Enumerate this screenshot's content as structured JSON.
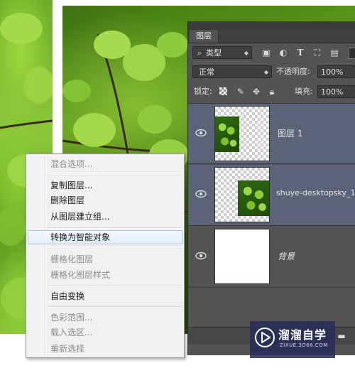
{
  "layers_panel": {
    "tab_title": "图层",
    "filter_select": "类型",
    "blend_mode": "正常",
    "opacity_label": "不透明度:",
    "opacity_value": "100%",
    "lock_label": "锁定:",
    "fill_label": "填充:",
    "fill_value": "100%",
    "layers": [
      {
        "name": "图层 1",
        "visible": true,
        "selected": true
      },
      {
        "name": "shuye-desktopsky_1-",
        "visible": true,
        "selected": true
      },
      {
        "name": "背景",
        "visible": true,
        "selected": false
      }
    ]
  },
  "context_menu": {
    "items": [
      {
        "label": "混合选项...",
        "enabled": false
      },
      {
        "label": "复制图层...",
        "enabled": true
      },
      {
        "label": "删除图层",
        "enabled": true
      },
      {
        "label": "从图层建立组...",
        "enabled": true
      },
      {
        "label": "转换为智能对象",
        "enabled": true,
        "highlighted": true
      },
      {
        "label": "栅格化图层",
        "enabled": false
      },
      {
        "label": "栅格化图层样式",
        "enabled": false
      },
      {
        "label": "自由变换",
        "enabled": true
      },
      {
        "label": "色彩范围...",
        "enabled": false
      },
      {
        "label": "载入选区...",
        "enabled": false
      },
      {
        "label": "重新选择",
        "enabled": false
      }
    ]
  },
  "watermark": {
    "title": "溜溜自学",
    "subtitle": "ZIXUE.3D66.COM"
  },
  "colors": {
    "panel_bg": "#535353",
    "selected_layer": "#5b6378",
    "menu_bg": "#f1f1f1",
    "menu_highlight_border": "#a8c8ec"
  },
  "icons": {
    "filter": "search-icon",
    "layer_visibility": "eye-icon",
    "lock_transparent": "checkerboard-lock-icon",
    "lock_image": "brush-icon",
    "lock_position": "move-icon",
    "lock_all": "padlock-icon"
  }
}
